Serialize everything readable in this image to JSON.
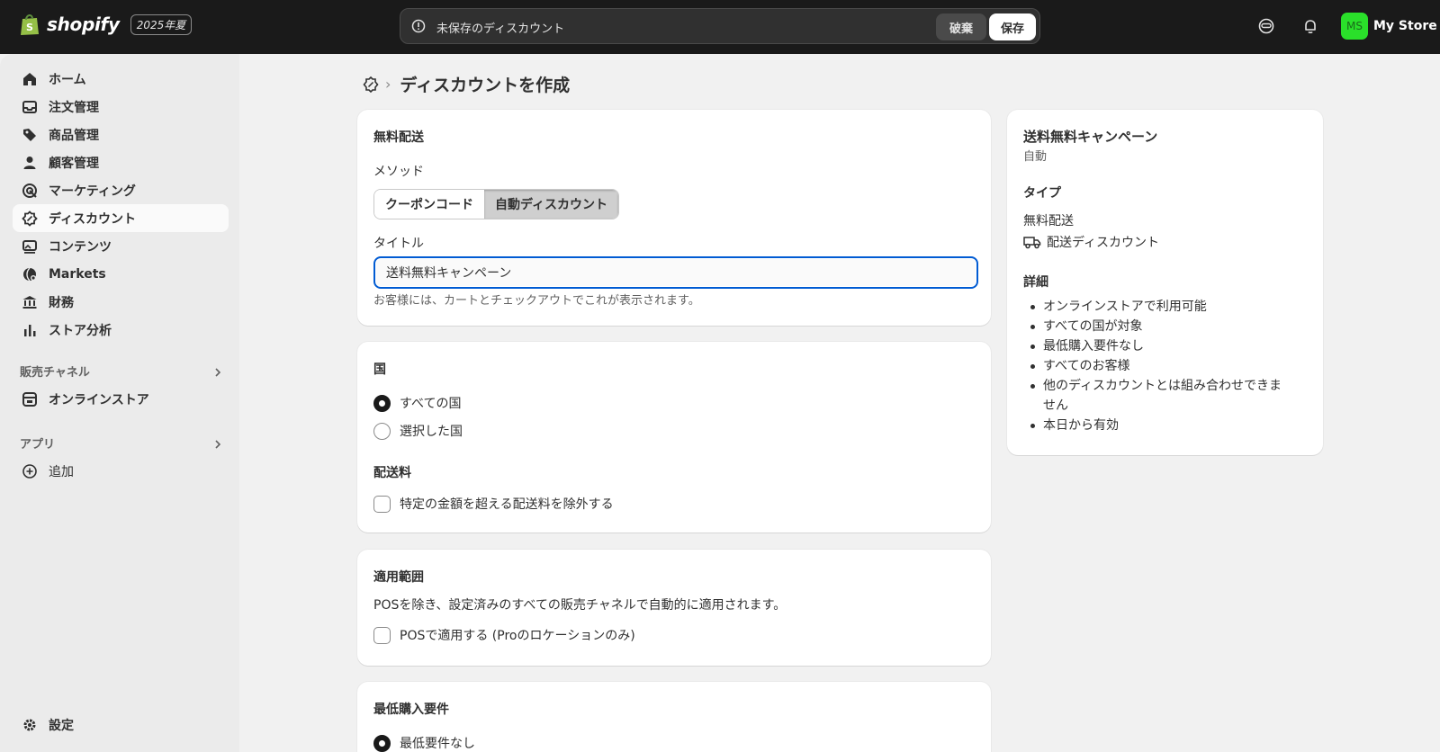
{
  "topbar": {
    "brand": "shopify",
    "edition_badge": "2025年夏",
    "unsaved_text": "未保存のディスカウント",
    "discard_label": "破棄",
    "save_label": "保存",
    "store_initials": "MS",
    "store_name": "My Store"
  },
  "sidebar": {
    "items": [
      {
        "label": "ホーム",
        "icon": "home-icon"
      },
      {
        "label": "注文管理",
        "icon": "inbox-icon"
      },
      {
        "label": "商品管理",
        "icon": "tag-icon"
      },
      {
        "label": "顧客管理",
        "icon": "person-icon"
      },
      {
        "label": "マーケティング",
        "icon": "target-icon"
      },
      {
        "label": "ディスカウント",
        "icon": "discount-icon"
      },
      {
        "label": "コンテンツ",
        "icon": "image-icon"
      },
      {
        "label": "Markets",
        "icon": "globe-icon"
      },
      {
        "label": "財務",
        "icon": "bank-icon"
      },
      {
        "label": "ストア分析",
        "icon": "bar-chart-icon"
      }
    ],
    "sales_channels_title": "販売チャネル",
    "online_store_label": "オンラインストア",
    "apps_title": "アプリ",
    "add_label": "追加",
    "settings_label": "設定"
  },
  "page": {
    "title": "ディスカウントを作成"
  },
  "method_card": {
    "title": "無料配送",
    "method_label": "メソッド",
    "method_options": [
      "クーポンコード",
      "自動ディスカウント"
    ],
    "method_selected": "自動ディスカウント",
    "title_label": "タイトル",
    "title_value": "送料無料キャンペーン",
    "help_text": "お客様には、カートとチェックアウトでこれが表示されます。"
  },
  "country_card": {
    "title": "国",
    "option_all": "すべての国",
    "option_selected": "選択した国",
    "shipping_rates_title": "配送料",
    "exclude_label": "特定の金額を超える配送料を除外する"
  },
  "scope_card": {
    "title": "適用範囲",
    "description": "POSを除き、設定済みのすべての販売チャネルで自動的に適用されます。",
    "pos_label": "POSで適用する (Proのロケーションのみ)"
  },
  "min_card": {
    "title": "最低購入要件",
    "option_none": "最低要件なし"
  },
  "summary": {
    "name": "送料無料キャンペーン",
    "mode": "自動",
    "type_title": "タイプ",
    "type_value": "無料配送",
    "type_detail": "配送ディスカウント",
    "details_title": "詳細",
    "details": [
      "オンラインストアで利用可能",
      "すべての国が対象",
      "最低購入要件なし",
      "すべてのお客様",
      "他のディスカウントとは組み合わせできません",
      "本日から有効"
    ]
  },
  "colors": {
    "topbar_bg": "#1a1a1a",
    "focus_ring": "#005bd3",
    "avatar_bg": "#2ae02a"
  }
}
